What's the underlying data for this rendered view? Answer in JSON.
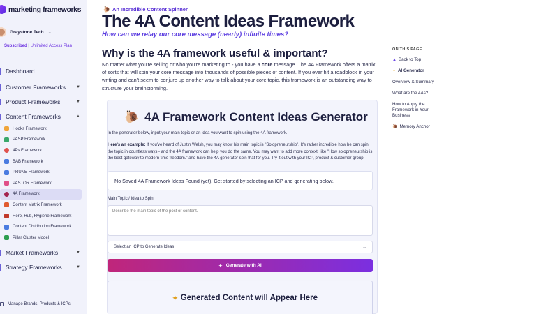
{
  "brand": {
    "name": "marketing frameworks"
  },
  "account": {
    "name": "Graystone Tech",
    "subscribed": "Subscribed",
    "separator": " | ",
    "plan": "Unlimited Access Plan"
  },
  "nav": {
    "dashboard": "Dashboard",
    "customer_frameworks": "Customer Frameworks",
    "product_frameworks": "Product Frameworks",
    "content_frameworks": "Content Frameworks",
    "market_frameworks": "Market Frameworks",
    "strategy_frameworks": "Strategy Frameworks",
    "content_items": [
      {
        "label": "Hooks Framework",
        "color": "#f0a53a"
      },
      {
        "label": "PASP Framework",
        "color": "#3aa86b"
      },
      {
        "label": "4Ps Framework",
        "color": "#e0524f"
      },
      {
        "label": "BAB Framework",
        "color": "#4a7be0"
      },
      {
        "label": "PRUNE Framework",
        "color": "#4a7be0"
      },
      {
        "label": "PASTOR Framework",
        "color": "#e04f88"
      },
      {
        "label": "4A Framework",
        "color": "#a3234f"
      },
      {
        "label": "Content Matrix Framework",
        "color": "#e05a2f"
      },
      {
        "label": "Hero, Hub, Hygiene Framework",
        "color": "#c0392b"
      },
      {
        "label": "Content Distribution Framework",
        "color": "#4a7be0"
      },
      {
        "label": "Pillar Cluster Model",
        "color": "#2e9e4f"
      }
    ],
    "manage": "Manage Brands, Products & ICPs"
  },
  "header": {
    "badge": "An Incredible Content Spinner",
    "title": "The 4A Content Ideas Framework",
    "subtitle": "How can we relay our core message (nearly) infinite times?"
  },
  "section": {
    "heading": "Why is the 4A framework useful & important?",
    "p1": "No matter what you're selling or who you're marketing to - you have a ",
    "core": "core",
    "p2": " message. ",
    "p3": "The 4A Framework offers a matrix of sorts that will spin your core message into thousands of possible pieces of content. If you ever hit a roadblock in your writing and can't seem to conjure up another way to talk about your core topic, this framework is an outstanding way to structure your brainstorming."
  },
  "otp": {
    "title": "ON THIS PAGE",
    "items": [
      {
        "label": "Back to Top",
        "icon": "up-arrow-icon"
      },
      {
        "label": "AI Generator",
        "icon": "sparkle-icon"
      },
      {
        "label": "Overview & Summary",
        "icon": ""
      },
      {
        "label": "What are the 4As?",
        "icon": ""
      },
      {
        "label": "How to Apply the Framework in Your Business",
        "icon": ""
      },
      {
        "label": "Memory Anchor",
        "icon": "snail-icon"
      }
    ]
  },
  "generator": {
    "title": "4A Framework Content Ideas Generator",
    "intro": "In the generator below, input your main topic or an idea you want to spin using the 4A framework.",
    "example_label": "Here's an example:",
    "example_text": " If you've heard of Justin Welsh, you may know his main topic is \"Solopreneurship\". It's rather incredible how he can spin the topic in countless ways - and the 4A framework can help you do the same. You may want to add more context, like \"How solopreneurship is the best gateway to modern time freedom.\" and have the 4A generator spin that for you. Try it out with your ICP, product & customer group.",
    "notice": "No Saved 4A Framework Ideas Found (yet). Get started by selecting an ICP and generating below.",
    "field_label": "Main Topic / Idea to Spin",
    "placeholder": "Describe the main topic of the post or content.",
    "select_label": "Select an ICP to Generate Ideas",
    "button": "Generate with AI",
    "output_title": "Generated Content will Appear Here"
  }
}
